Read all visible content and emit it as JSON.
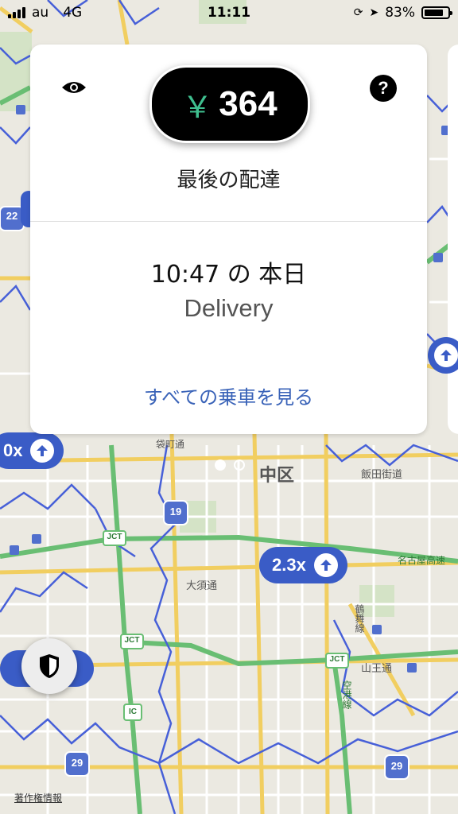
{
  "status": {
    "carrier": "au",
    "network": "4G",
    "time": "11:11",
    "battery": "83%",
    "battery_level": 0.83
  },
  "card": {
    "currency_symbol": "￥",
    "fare": "364",
    "subtitle": "最後の配達",
    "time_line": "10:47 の 本日",
    "trip_type": "Delivery",
    "see_all_link": "すべての乗車を見る"
  },
  "pager": {
    "current": 1,
    "total": 2
  },
  "map": {
    "ward_label": "中区",
    "surge_a": "2.3x",
    "surge_b": "0x",
    "route_22": "22",
    "route_19": "19",
    "route_29": "29",
    "jct": "JCT",
    "ic": "IC",
    "street_1": "大須通",
    "street_2": "山王通",
    "street_3": "袋町通",
    "street_4": "飯田街道",
    "street_5": "名古屋高速",
    "street_6": "空港線",
    "street_7": "鶴舞線",
    "attribution": "著作権情報"
  },
  "colors": {
    "accent_green": "#3fbf8f",
    "surge_blue": "#3a5cc6",
    "link_blue": "#3a63b8",
    "zone_line": "#2e4bd3",
    "highway": "#55b660"
  }
}
